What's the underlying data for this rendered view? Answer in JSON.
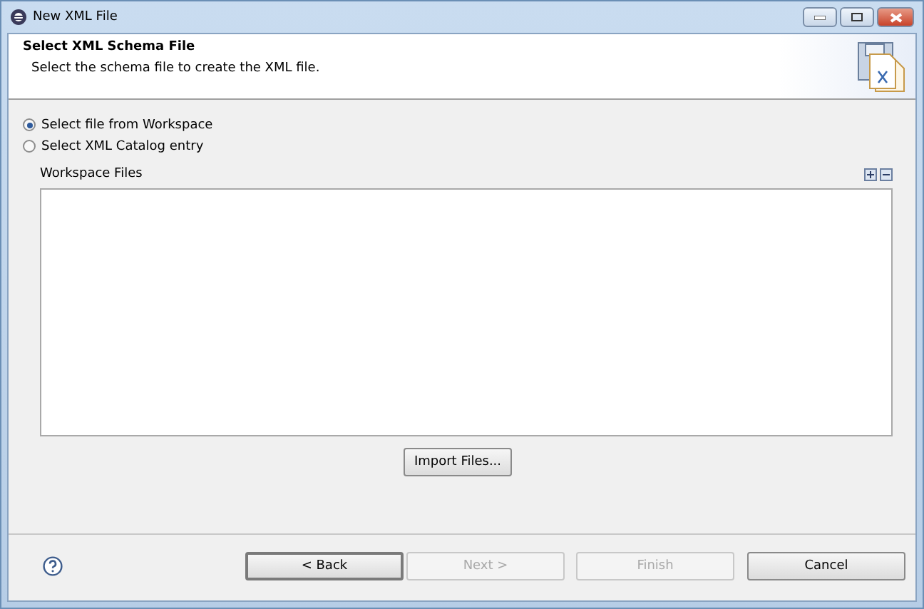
{
  "window": {
    "title": "New XML File"
  },
  "header": {
    "title": "Select XML Schema File",
    "description": "Select the schema file to create the XML file."
  },
  "source_options": [
    {
      "label": "Select file from Workspace",
      "selected": true
    },
    {
      "label": "Select XML Catalog entry",
      "selected": false
    }
  ],
  "workspace_files": {
    "label": "Workspace Files"
  },
  "import_button": "Import Files...",
  "buttons": [
    {
      "label": "< Back",
      "disabled": false,
      "default": true
    },
    {
      "label": "Next >",
      "disabled": true,
      "default": false
    },
    {
      "label": "Finish",
      "disabled": true,
      "default": false
    },
    {
      "label": "Cancel",
      "disabled": false,
      "default": false
    }
  ]
}
